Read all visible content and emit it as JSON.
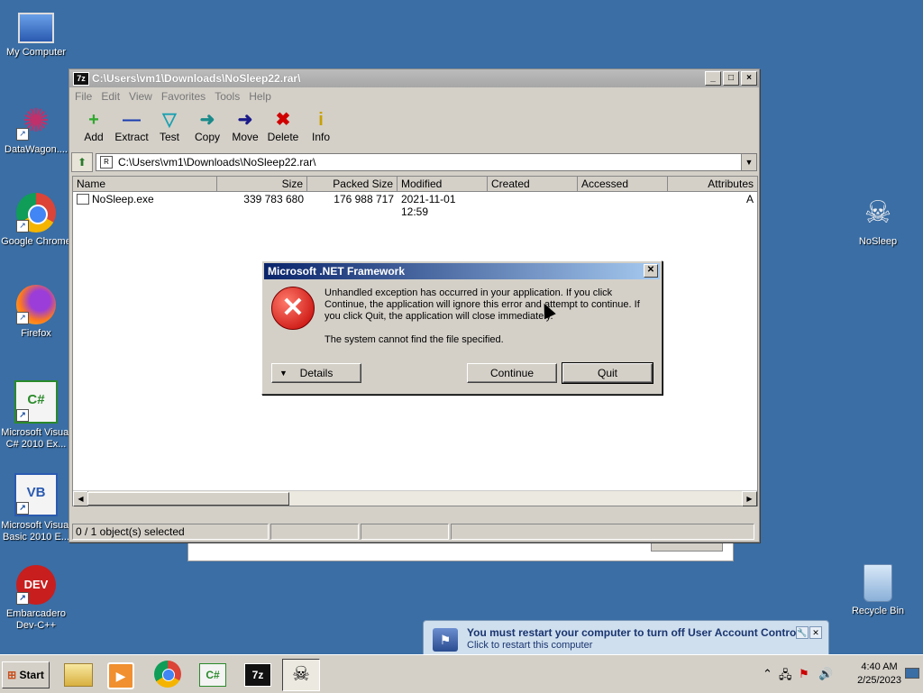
{
  "desktop": {
    "icons": [
      {
        "label": "My Computer",
        "glyph": "🖥"
      },
      {
        "label": "DataWagon....",
        "glyph": "✺"
      },
      {
        "label": "Google Chrome",
        "glyph": "◉"
      },
      {
        "label": "Firefox",
        "glyph": "🦊"
      },
      {
        "label": "Microsoft Visual C# 2010 Ex...",
        "glyph": "C#"
      },
      {
        "label": "Microsoft Visual Basic 2010 E...",
        "glyph": "VB"
      },
      {
        "label": "Embarcadero Dev-C++",
        "glyph": "DEV"
      },
      {
        "label": "NoSleep",
        "glyph": "☠"
      },
      {
        "label": "Recycle Bin",
        "glyph": "🗑"
      }
    ]
  },
  "sevenzip": {
    "title": "C:\\Users\\vm1\\Downloads\\NoSleep22.rar\\",
    "app_icon": "7z",
    "menu": [
      "File",
      "Edit",
      "View",
      "Favorites",
      "Tools",
      "Help"
    ],
    "toolbar": [
      {
        "label": "Add",
        "glyph": "+",
        "color": "#2ea82e"
      },
      {
        "label": "Extract",
        "glyph": "—",
        "color": "#1a3cb0"
      },
      {
        "label": "Test",
        "glyph": "▽",
        "color": "#1aa0b0"
      },
      {
        "label": "Copy",
        "glyph": "➜",
        "color": "#1a8a8a"
      },
      {
        "label": "Move",
        "glyph": "➜",
        "color": "#1a1a8a"
      },
      {
        "label": "Delete",
        "glyph": "✖",
        "color": "#d00000"
      },
      {
        "label": "Info",
        "glyph": "i",
        "color": "#c8a000"
      }
    ],
    "address": "C:\\Users\\vm1\\Downloads\\NoSleep22.rar\\",
    "columns": [
      "Name",
      "Size",
      "Packed Size",
      "Modified",
      "Created",
      "Accessed",
      "Attributes"
    ],
    "rows": [
      {
        "name": "NoSleep.exe",
        "size": "339 783 680",
        "packed": "176 988 717",
        "modified": "2021-11-01 12:59",
        "created": "",
        "accessed": "",
        "attributes": "A"
      }
    ],
    "status": "0 / 1 object(s) selected"
  },
  "dialog": {
    "title": "Microsoft .NET Framework",
    "message": "Unhandled exception has occurred in your application. If you click Continue, the application will ignore this error and attempt to continue. If you click Quit, the application will close immediately.",
    "detail": "The system cannot find the file specified.",
    "details_label": "Details",
    "continue_label": "Continue",
    "quit_label": "Quit"
  },
  "balloon": {
    "title": "You must restart your computer to turn off User Account Control",
    "subtitle": "Click to restart this computer"
  },
  "taskbar": {
    "start_label": "Start",
    "apps": [
      "explorer-icon",
      "media-player-icon",
      "chrome-icon",
      "csharp-icon",
      "sevenzip-icon",
      "nosleep-icon"
    ],
    "clock_time": "4:40 AM",
    "clock_date": "2/25/2023"
  },
  "colors": {
    "desktop": "#3a6ea5",
    "dialog_title": "#0a246a"
  }
}
